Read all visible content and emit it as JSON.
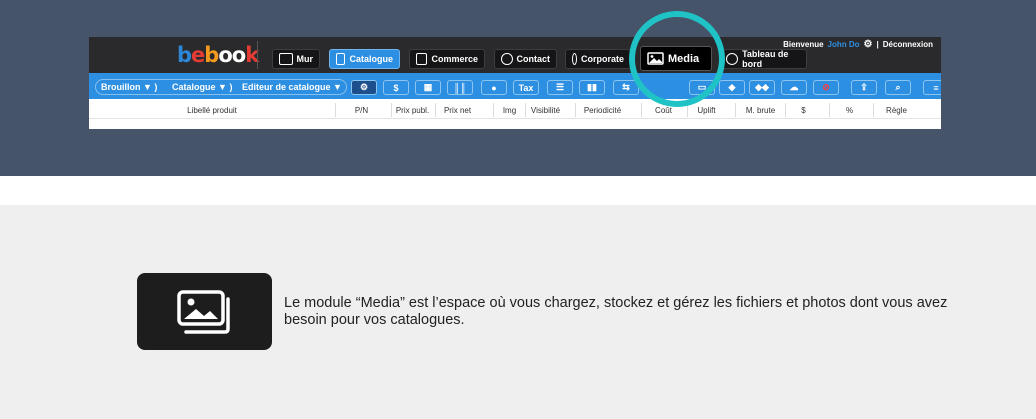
{
  "app": {
    "logo": [
      "b",
      "e",
      "b",
      "oo",
      "k"
    ],
    "welcome": {
      "greeting": "Bienvenue",
      "user": "John Do",
      "separator": "|",
      "logout": "Déconnexion"
    },
    "nav": [
      {
        "label": "Mur",
        "icon": "edit-icon"
      },
      {
        "label": "Catalogue",
        "icon": "catalogue-icon",
        "active": true
      },
      {
        "label": "Commerce",
        "icon": "commerce-icon"
      },
      {
        "label": "Contact",
        "icon": "contact-icon"
      },
      {
        "label": "Corporate",
        "icon": "corporate-icon"
      },
      {
        "label": "Media",
        "icon": "image-icon"
      },
      {
        "label": "Tableau de bord",
        "icon": "dashboard-icon"
      }
    ],
    "breadcrumb": {
      "draft": "Brouillon",
      "catalogue": "Catalogue",
      "editor": "Editeur de catalogue",
      "arrow": "▼ )"
    },
    "toolbar_labels": {
      "dollar": "$",
      "tax": "Tax"
    },
    "columns": [
      "Libellé produit",
      "P/N",
      "Prix publ.",
      "Prix net",
      "Img",
      "Visibilité",
      "Periodicité",
      "Coût",
      "Uplift",
      "M. brute",
      "$",
      "%",
      "Règle"
    ]
  },
  "description": "Le module “Media” est l’espace où vous chargez, stockez et gérez les fichiers et photos dont vous avez besoin pour vos catalogues.",
  "colors": {
    "hero_bg": "#465469",
    "highlight": "#1fc2c5",
    "brand_blue": "#2d8fe1",
    "content_bg": "#efefef"
  }
}
